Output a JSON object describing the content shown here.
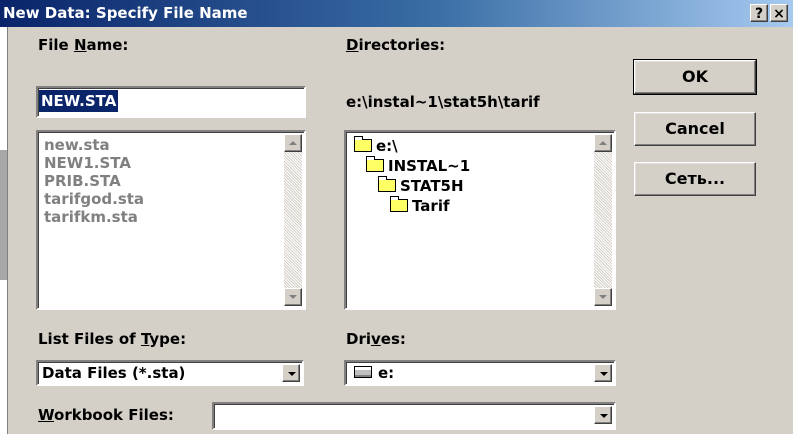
{
  "window": {
    "title": "New Data: Specify File Name",
    "help_btn": "?",
    "close_btn": "×"
  },
  "file_name": {
    "label_pre": "File ",
    "label_u": "N",
    "label_post": "ame:",
    "value": "NEW.STA",
    "files": [
      "new.sta",
      "NEW1.STA",
      "PRIB.STA",
      "tarifgod.sta",
      "tarifkm.sta"
    ]
  },
  "directories": {
    "label_u": "D",
    "label_post": "irectories:",
    "path": "e:\\instal~1\\stat5h\\tarif",
    "tree": [
      "e:\\",
      "INSTAL~1",
      "STAT5H",
      "Tarif"
    ]
  },
  "buttons": {
    "ok": "OK",
    "cancel": "Cancel",
    "network": "Сеть..."
  },
  "list_type": {
    "label_pre": "List Files of ",
    "label_u": "T",
    "label_post": "ype:",
    "value": "Data Files (*.sta)"
  },
  "drives": {
    "label_pre": "Dri",
    "label_u": "v",
    "label_post": "es:",
    "value": "e:"
  },
  "workbook": {
    "label_u": "W",
    "label_post": "orkbook Files:",
    "value": ""
  }
}
